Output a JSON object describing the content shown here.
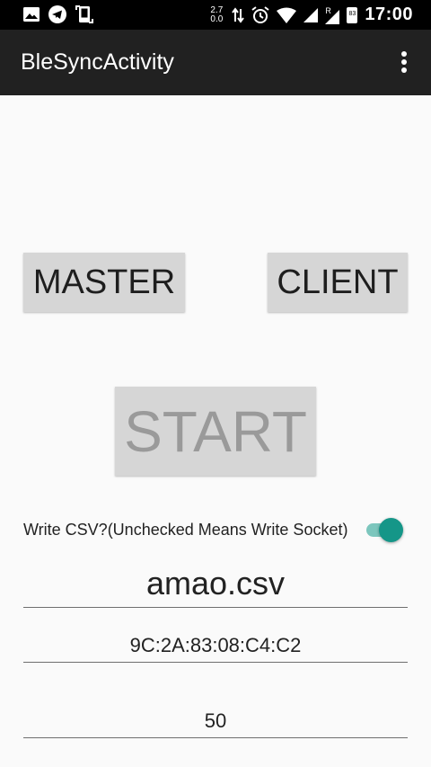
{
  "status_bar": {
    "net_speed_up": "2.7",
    "net_speed_down": "0.0",
    "roaming_indicator": "R",
    "battery_level": "83",
    "clock": "17:00",
    "left_icons": [
      "image-icon",
      "telegram-icon",
      "screenshot-icon"
    ],
    "right_icons": [
      "data-arrows-icon",
      "alarm-icon",
      "wifi-icon",
      "signal-icon",
      "signal-roaming-icon",
      "battery-icon"
    ]
  },
  "toolbar": {
    "title": "BleSyncActivity",
    "menu_icon": "more-vert-icon"
  },
  "buttons": {
    "master": "MASTER",
    "client": "CLIENT",
    "start": "START",
    "start_enabled": false
  },
  "write_csv": {
    "label": "Write CSV?(Unchecked Means Write Socket)",
    "checked": true,
    "accent_color": "#159688"
  },
  "fields": {
    "filename": "amao.csv",
    "mac_address": "9C:2A:83:08:C4:C2",
    "number": "50"
  }
}
